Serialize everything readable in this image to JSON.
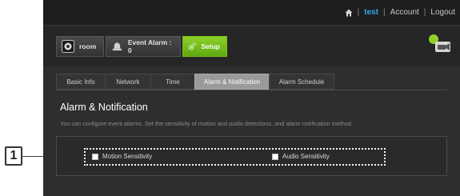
{
  "callout": {
    "number": "1"
  },
  "topnav": {
    "user": "test",
    "account": "Account",
    "logout": "Logout",
    "sep": "|"
  },
  "toolbar": {
    "room_label": "room",
    "event_label": "Event Alarm : 0",
    "setup_label": "Setup",
    "setup_color": "#7cc31e"
  },
  "tabs": [
    {
      "label": "Basic Info"
    },
    {
      "label": "Network"
    },
    {
      "label": "Time"
    },
    {
      "label": "Alarm & Notification"
    },
    {
      "label": "Alarm Schedule"
    }
  ],
  "section": {
    "title": "Alarm & Notification",
    "description": "You can configure event alarms. Set the sensitivity of motion and audio detections, and alarm notification method."
  },
  "options": {
    "motion_label": "Motion Sensitivity",
    "audio_label": "Audio Sensitivity"
  },
  "colors": {
    "accent": "#2fa6e6",
    "background": "#2b2b2b"
  },
  "icons": [
    "home-icon",
    "room-camera-icon",
    "event-alarm-icon",
    "setup-gear-icon",
    "camera-user-icon"
  ]
}
